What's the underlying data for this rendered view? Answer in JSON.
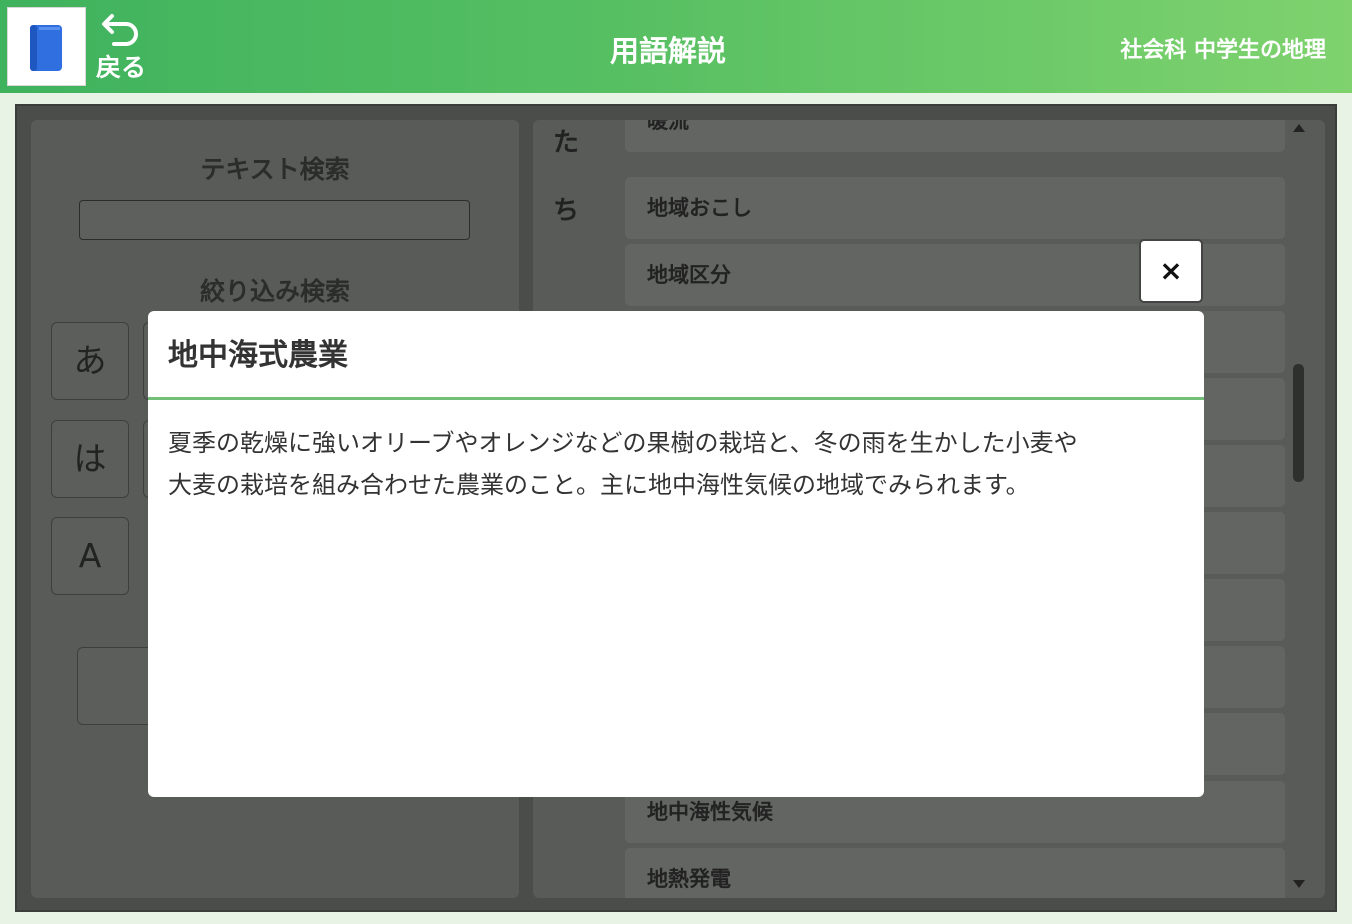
{
  "header": {
    "back_label": "戻る",
    "title": "用語解説",
    "subject": "社会科 中学生の地理",
    "logo_icon": "book-icon",
    "back_icon": "undo-arrow-icon"
  },
  "left_panel": {
    "text_search_label": "テキスト検索",
    "text_search_value": "",
    "filter_label": "絞り込み検索",
    "filter_buttons": [
      "あ",
      "は",
      "A"
    ]
  },
  "term_list": {
    "index_letters": [
      "た",
      "ち"
    ],
    "terms": [
      "暖流",
      "地域おこし",
      "地域区分",
      "地中海性気候",
      "地熱発電"
    ]
  },
  "modal": {
    "title": "地中海式農業",
    "body_line1": "夏季の乾燥に強いオリーブやオレンジなどの果樹の栽培と、冬の雨を生かした小麦や",
    "body_line2": "大麦の栽培を組み合わせた農業のこと。主に地中海性気候の地域でみられます。",
    "close_label": "×"
  },
  "colors": {
    "header_start": "#3fb25e",
    "header_end": "#7fd26e",
    "modal_divider": "#72bf78",
    "overlay": "#4a4d49"
  }
}
